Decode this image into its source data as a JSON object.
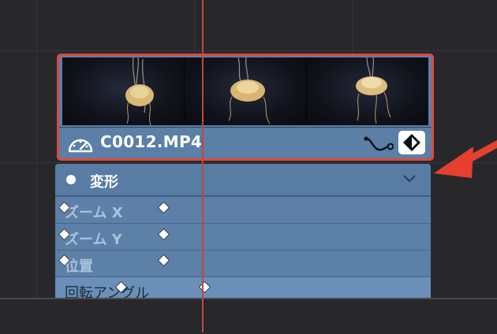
{
  "clip": {
    "name": "C0012.MP4",
    "speed_icon": "speedometer-icon",
    "curve_icon": "curve-icon",
    "keyframe_icon": "keyframe-diamond-icon",
    "border_color": "#e0483e",
    "fill_color": "#5b7fa6"
  },
  "transform": {
    "title": "変形",
    "toggle_icon": "chevron-down-icon",
    "rows": [
      {
        "label": "ズーム X"
      },
      {
        "label": "ズーム Y"
      },
      {
        "label": "位置"
      },
      {
        "label": "回転アングル"
      }
    ]
  },
  "playhead_color": "#c0473f",
  "annotation_arrow_color": "#e5412e"
}
